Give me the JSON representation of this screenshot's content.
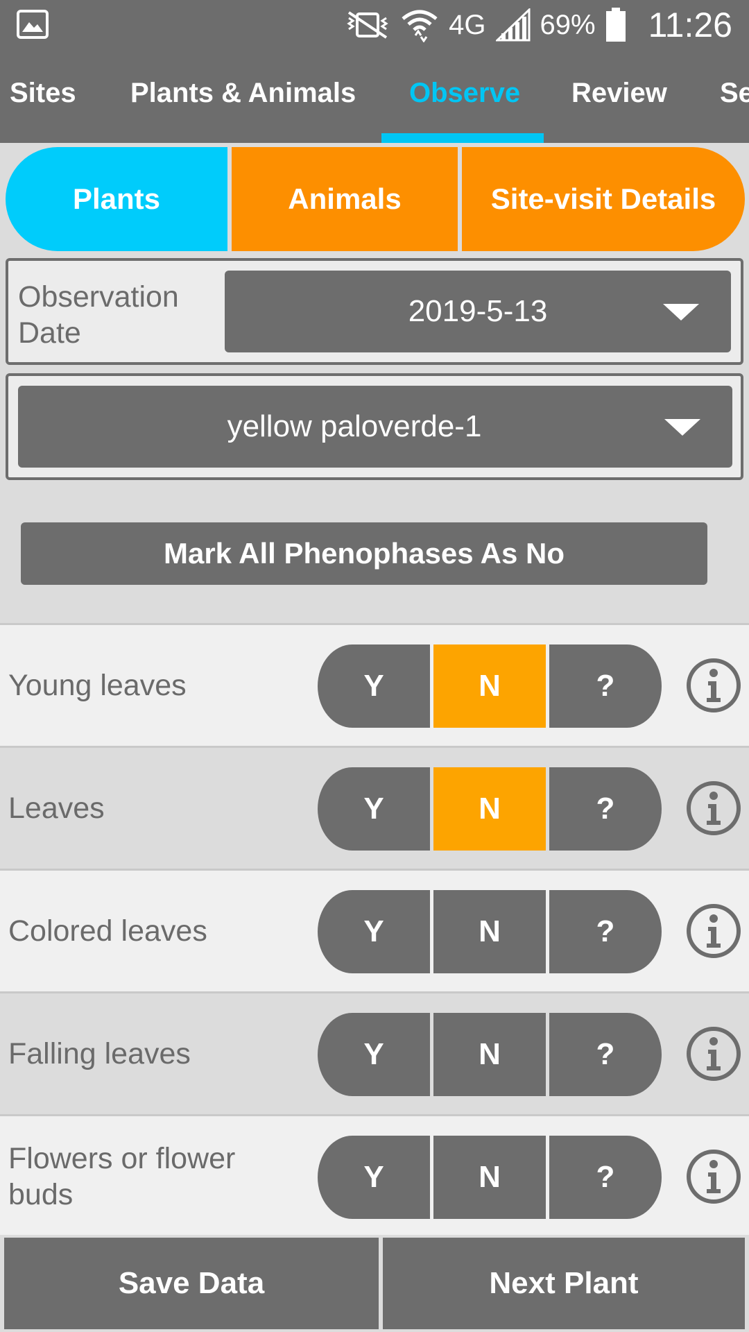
{
  "status_bar": {
    "battery": "69%",
    "time": "11:26",
    "network": "4G",
    "icons": [
      "gallery-icon",
      "vibrate-mute-icon",
      "wifi-icon",
      "lte-icon",
      "signal-icon",
      "battery-icon"
    ]
  },
  "top_tabs": {
    "items": [
      "Sites",
      "Plants & Animals",
      "Observe",
      "Review",
      "Se"
    ],
    "active": "Observe",
    "accent_color": "#00c6f4"
  },
  "segment": {
    "plants": "Plants",
    "animals": "Animals",
    "site_visit": "Site-visit Details",
    "active": "Plants",
    "active_color": "#00ccfb",
    "inactive_color": "#fd8f00"
  },
  "observation": {
    "label": "Observation Date",
    "date": "2019-5-13"
  },
  "plant": {
    "selected": "yellow paloverde-1"
  },
  "mark_all_label": "Mark All Phenophases As No",
  "phenophases": [
    {
      "label": "Young leaves",
      "selected": "N"
    },
    {
      "label": "Leaves",
      "selected": "N"
    },
    {
      "label": "Colored leaves",
      "selected": null
    },
    {
      "label": "Falling leaves",
      "selected": null
    },
    {
      "label": "Flowers or flower buds",
      "selected": null
    }
  ],
  "options": {
    "y": "Y",
    "n": "N",
    "q": "?"
  },
  "selected_color": "#fda400",
  "bottom": {
    "save": "Save Data",
    "next": "Next Plant"
  }
}
